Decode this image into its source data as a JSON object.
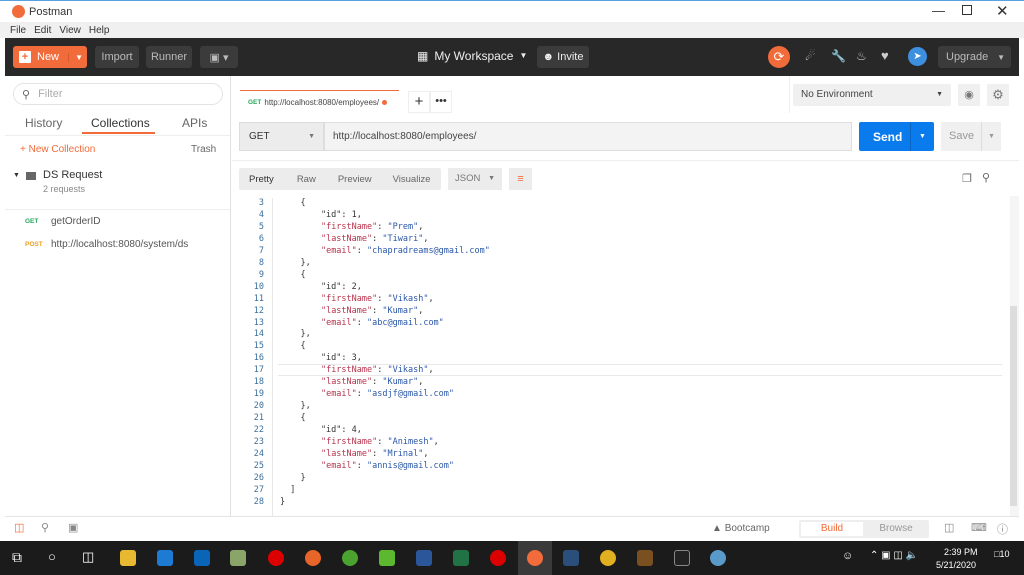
{
  "window": {
    "title": "Postman"
  },
  "menu": [
    "File",
    "Edit",
    "View",
    "Help"
  ],
  "toolbar": {
    "new": "New",
    "import": "Import",
    "runner": "Runner",
    "workspace": "My Workspace",
    "invite": "Invite",
    "upgrade": "Upgrade"
  },
  "sidebar": {
    "filter_placeholder": "Filter",
    "tabs": [
      "History",
      "Collections",
      "APIs"
    ],
    "new_collection": "+ New Collection",
    "trash": "Trash",
    "collection": {
      "name": "DS Request",
      "count": "2 requests"
    },
    "requests": [
      {
        "method": "GET",
        "name": "getOrderID"
      },
      {
        "method": "POST",
        "name": "http://localhost:8080/system/ds"
      }
    ]
  },
  "tab": {
    "method": "GET",
    "url": "http://localhost:8080/employees/"
  },
  "environment": "No Environment",
  "request": {
    "method": "GET",
    "url": "http://localhost:8080/employees/",
    "send": "Send",
    "save": "Save"
  },
  "response": {
    "views": [
      "Pretty",
      "Raw",
      "Preview",
      "Visualize"
    ],
    "format": "JSON",
    "lines": [
      {
        "n": "3",
        "t": "    {"
      },
      {
        "n": "4",
        "t": "        \"id\": 1,"
      },
      {
        "n": "5",
        "t": "        \"firstName\": \"Prem\","
      },
      {
        "n": "6",
        "t": "        \"lastName\": \"Tiwari\","
      },
      {
        "n": "7",
        "t": "        \"email\": \"chapradreams@gmail.com\""
      },
      {
        "n": "8",
        "t": "    },"
      },
      {
        "n": "9",
        "t": "    {"
      },
      {
        "n": "10",
        "t": "        \"id\": 2,"
      },
      {
        "n": "11",
        "t": "        \"firstName\": \"Vikash\","
      },
      {
        "n": "12",
        "t": "        \"lastName\": \"Kumar\","
      },
      {
        "n": "13",
        "t": "        \"email\": \"abc@gmail.com\""
      },
      {
        "n": "14",
        "t": "    },"
      },
      {
        "n": "15",
        "t": "    {"
      },
      {
        "n": "16",
        "t": "        \"id\": 3,"
      },
      {
        "n": "17",
        "t": "        \"firstName\": \"Vikash\","
      },
      {
        "n": "18",
        "t": "        \"lastName\": \"Kumar\","
      },
      {
        "n": "19",
        "t": "        \"email\": \"asdjf@gmail.com\""
      },
      {
        "n": "20",
        "t": "    },"
      },
      {
        "n": "21",
        "t": "    {"
      },
      {
        "n": "22",
        "t": "        \"id\": 4,"
      },
      {
        "n": "23",
        "t": "        \"firstName\": \"Animesh\","
      },
      {
        "n": "24",
        "t": "        \"lastName\": \"Mrinal\","
      },
      {
        "n": "25",
        "t": "        \"email\": \"annis@gmail.com\""
      },
      {
        "n": "26",
        "t": "    }"
      },
      {
        "n": "27",
        "t": "  ]"
      },
      {
        "n": "28",
        "t": "}"
      }
    ]
  },
  "status": {
    "bootcamp": "Bootcamp",
    "build": "Build",
    "browse": "Browse"
  },
  "taskbar": {
    "time": "2:39 PM",
    "date": "5/21/2020",
    "notifications": "10"
  },
  "colors": {
    "accent": "#f26b3a",
    "send": "#097bed"
  }
}
